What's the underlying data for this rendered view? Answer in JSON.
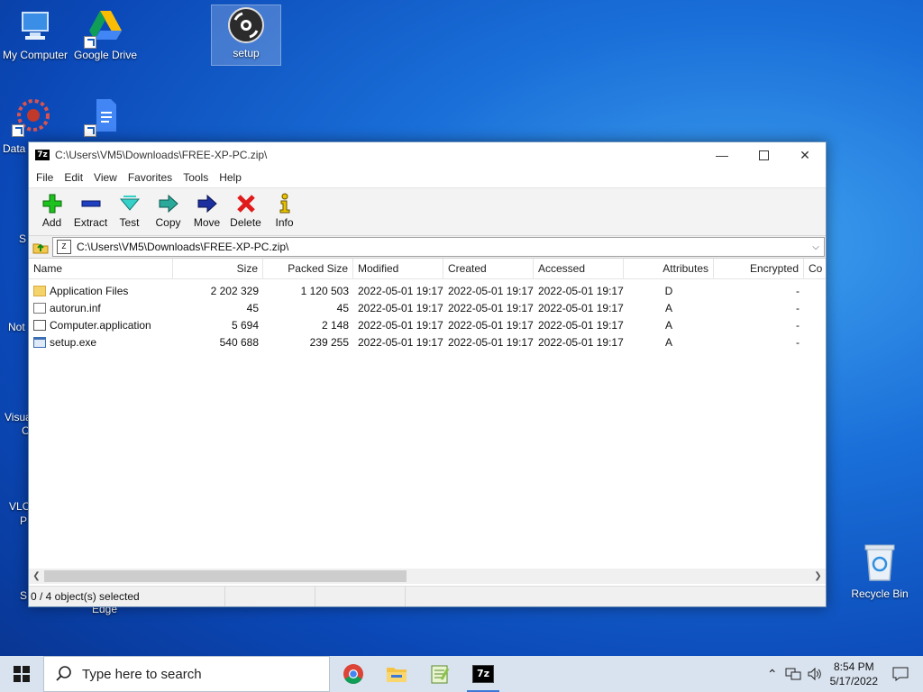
{
  "desktop": {
    "icons": [
      {
        "label": "My Computer"
      },
      {
        "label": "Google Drive"
      },
      {
        "label": "setup"
      }
    ],
    "partial_labels": [
      "Data",
      "S",
      "Not",
      "Visua",
      "C",
      "VLC",
      "P",
      "S",
      "Edge"
    ],
    "recycle_bin": "Recycle Bin"
  },
  "window": {
    "title": "C:\\Users\\VM5\\Downloads\\FREE-XP-PC.zip\\",
    "menu": [
      "File",
      "Edit",
      "View",
      "Favorites",
      "Tools",
      "Help"
    ],
    "toolbar": [
      "Add",
      "Extract",
      "Test",
      "Copy",
      "Move",
      "Delete",
      "Info"
    ],
    "address": "C:\\Users\\VM5\\Downloads\\FREE-XP-PC.zip\\",
    "columns": [
      "Name",
      "Size",
      "Packed Size",
      "Modified",
      "Created",
      "Accessed",
      "Attributes",
      "Encrypted",
      "Co"
    ],
    "rows": [
      {
        "name": "Application Files",
        "size": "2 202 329",
        "packed": "1 120 503",
        "modified": "2022-05-01 19:17",
        "created": "2022-05-01 19:17",
        "accessed": "2022-05-01 19:17",
        "attributes": "D",
        "encrypted": "-"
      },
      {
        "name": "autorun.inf",
        "size": "45",
        "packed": "45",
        "modified": "2022-05-01 19:17",
        "created": "2022-05-01 19:17",
        "accessed": "2022-05-01 19:17",
        "attributes": "A",
        "encrypted": "-"
      },
      {
        "name": "Computer.application",
        "size": "5 694",
        "packed": "2 148",
        "modified": "2022-05-01 19:17",
        "created": "2022-05-01 19:17",
        "accessed": "2022-05-01 19:17",
        "attributes": "A",
        "encrypted": "-"
      },
      {
        "name": "setup.exe",
        "size": "540 688",
        "packed": "239 255",
        "modified": "2022-05-01 19:17",
        "created": "2022-05-01 19:17",
        "accessed": "2022-05-01 19:17",
        "attributes": "A",
        "encrypted": "-"
      }
    ],
    "status": "0 / 4 object(s) selected"
  },
  "taskbar": {
    "search_placeholder": "Type here to search",
    "time": "8:54 PM",
    "date": "5/17/2022"
  },
  "colors": {
    "accent": "#3b78d8",
    "desktop": "#1a6fd8"
  }
}
